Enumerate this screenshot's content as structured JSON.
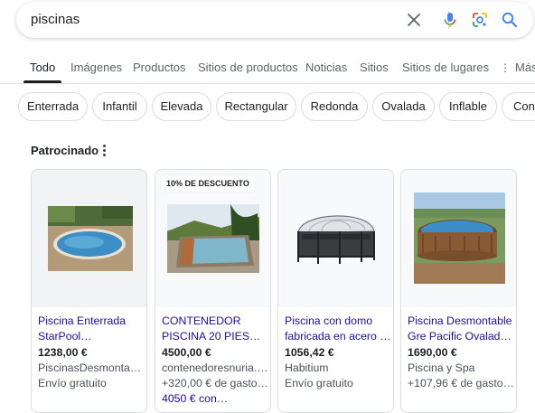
{
  "search": {
    "query": "piscinas",
    "icons": [
      "clear-icon",
      "microphone-icon",
      "lens-icon",
      "search-icon"
    ]
  },
  "tabs": [
    {
      "label": "Todo",
      "active": true
    },
    {
      "label": "Imágenes"
    },
    {
      "label": "Productos"
    },
    {
      "label": "Sitios de productos"
    },
    {
      "label": "Noticias"
    },
    {
      "label": "Sitios"
    },
    {
      "label": "Sitios de lugares"
    },
    {
      "label": "Más"
    }
  ],
  "chips": [
    "Enterrada",
    "Infantil",
    "Elevada",
    "Rectangular",
    "Redonda",
    "Ovalada",
    "Inflable",
    "Con"
  ],
  "sponsored": {
    "label": "Patrocinado"
  },
  "products": [
    {
      "title_line1": "Piscina Enterrada",
      "title_line2": "StarPool…",
      "price": "1238,00 €",
      "merchant": "PiscinasDesmontables",
      "shipping": "Envío gratuito",
      "image": "oval-inground-pool"
    },
    {
      "badge": "10% DE DESCUENTO",
      "title_line1": "CONTENEDOR",
      "title_line2": "PISCINA 20 PIES…",
      "price": "4500,00 €",
      "merchant": "contenedoresnuria.es",
      "shipping": "+320,00 € de gasto…",
      "extra": "4050 € con…",
      "image": "container-pool"
    },
    {
      "title_line1": "Piscina con domo",
      "title_line2": "fabricada en acero …",
      "price": "1056,42 €",
      "merchant": "Habitium",
      "shipping": "Envío gratuito",
      "image": "domed-steel-pool"
    },
    {
      "title_line1": "Piscina Desmontable",
      "title_line2": "Gre Pacific Ovalada…",
      "price": "1690,00 €",
      "merchant": "Piscina y Spa",
      "shipping": "+107,96 € de gasto…",
      "image": "wood-oval-pool"
    }
  ],
  "colors": {
    "link": "#1a0dab",
    "mic_blue": "#4285f4",
    "mic_red": "#ea4335",
    "lens_yellow": "#fbbc04",
    "lens_green": "#34a853"
  }
}
